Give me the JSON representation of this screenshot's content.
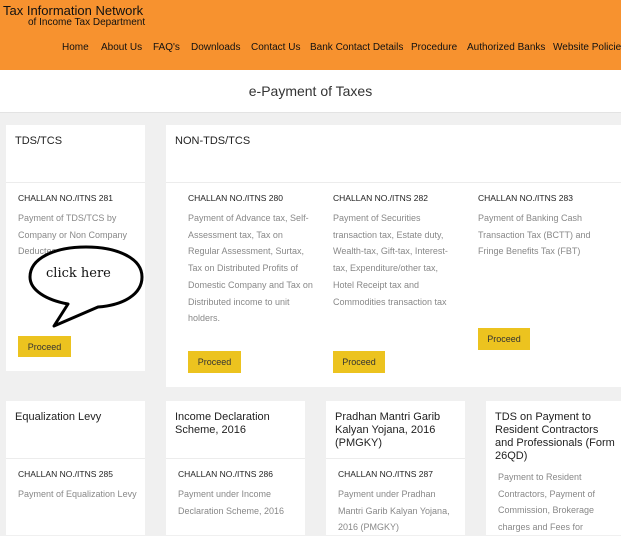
{
  "header": {
    "title": "Tax Information Network",
    "subtitle": "of Income Tax Department",
    "nav": [
      "Home",
      "About Us",
      "FAQ's",
      "Downloads",
      "Contact Us",
      "Bank Contact Details",
      "Procedure",
      "Authorized Banks",
      "Website Policies"
    ]
  },
  "page": {
    "title": "e-Payment of Taxes"
  },
  "tds": {
    "title": "TDS/TCS",
    "challan": "CHALLAN NO./ITNS 281",
    "desc": "Payment of TDS/TCS by Company or Non Company Deductees",
    "button": "Proceed"
  },
  "nontds": {
    "title": "NON-TDS/TCS",
    "items": [
      {
        "challan": "CHALLAN NO./ITNS 280",
        "desc": "Payment of Advance tax, Self-Assessment tax, Tax on Regular Assessment, Surtax, Tax on Distributed Profits of Domestic Company and Tax on Distributed income to unit holders.",
        "button": "Proceed"
      },
      {
        "challan": "CHALLAN NO./ITNS 282",
        "desc": "Payment of Securities transaction tax, Estate duty, Wealth-tax, Gift-tax, Interest-tax, Expenditure/other tax, Hotel Receipt tax and Commodities transaction tax",
        "button": "Proceed"
      },
      {
        "challan": "CHALLAN NO./ITNS 283",
        "desc": "Payment of Banking Cash Transaction Tax (BCTT) and Fringe Benefits Tax (FBT)",
        "button": "Proceed"
      }
    ]
  },
  "row2": [
    {
      "title": "Equalization Levy",
      "challan": "CHALLAN NO./ITNS 285",
      "desc": "Payment of Equalization Levy"
    },
    {
      "title": "Income Declaration Scheme, 2016",
      "challan": "CHALLAN NO./ITNS 286",
      "desc": "Payment under Income Declaration Scheme, 2016"
    },
    {
      "title": "Pradhan Mantri Garib Kalyan Yojana, 2016 (PMGKY)",
      "challan": "CHALLAN NO./ITNS 287",
      "desc": "Payment under Pradhan Mantri Garib Kalyan Yojana, 2016 (PMGKY)"
    },
    {
      "title": "TDS on Payment to Resident Contractors and Professionals (Form 26QD)",
      "desc": "Payment to Resident Contractors, Payment of Commission, Brokerage charges and Fees for"
    }
  ],
  "callout": {
    "text": "click here"
  }
}
